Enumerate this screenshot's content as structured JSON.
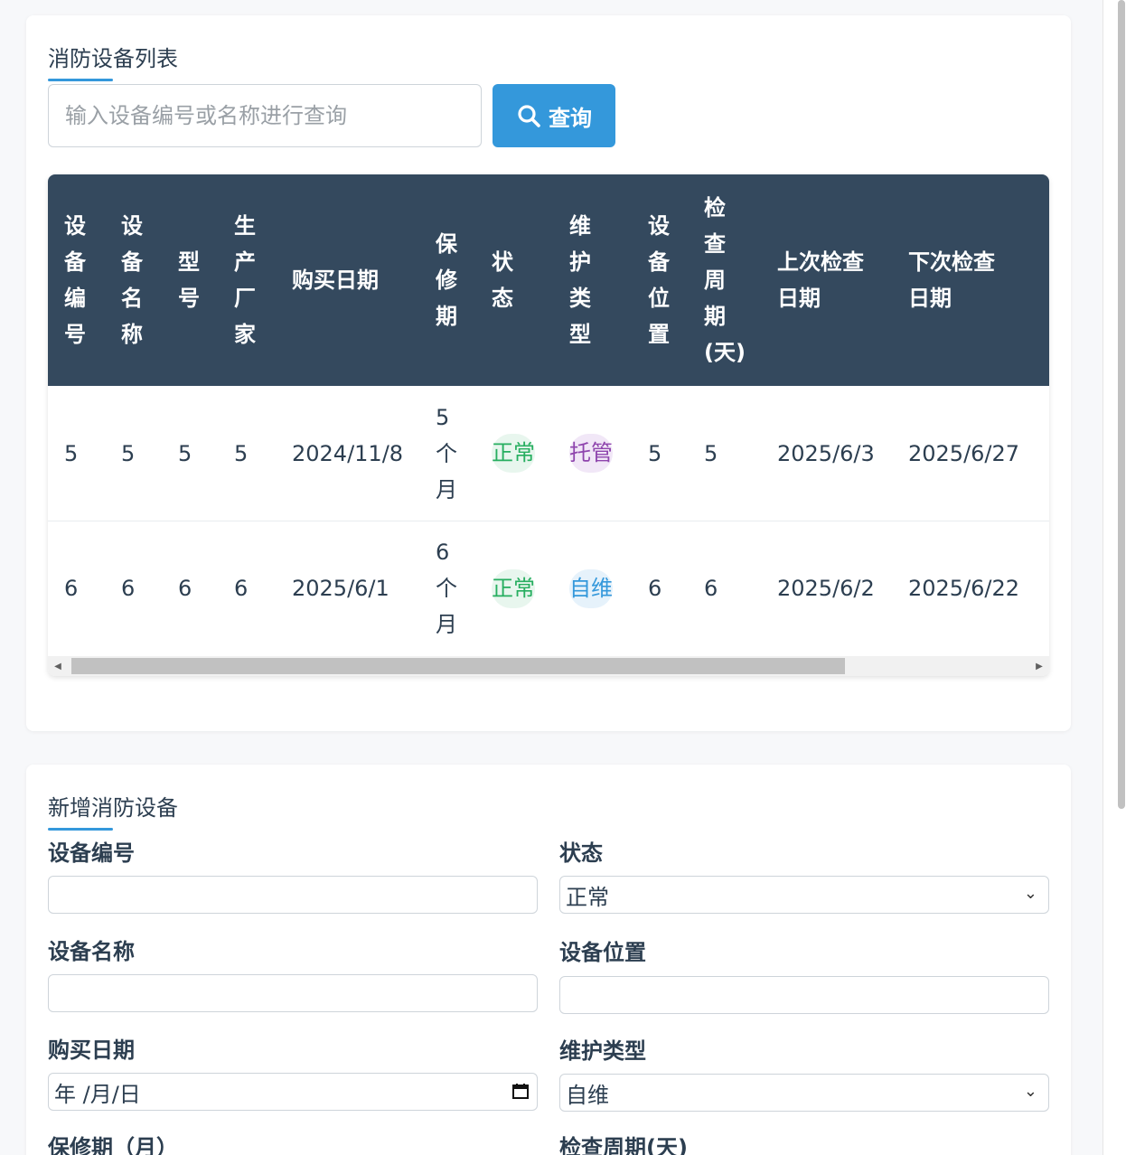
{
  "list": {
    "title": "消防设备列表",
    "search_placeholder": "输入设备编号或名称进行查询",
    "search_label": "查询",
    "headers": [
      "设备编号",
      "设备名称",
      "型号",
      "生产厂家",
      "购买日期",
      "保修期",
      "状态",
      "维护类型",
      "设备位置",
      "检查周期(天)",
      "上次检查日期",
      "下次检查日期"
    ],
    "rows": [
      {
        "id": "5",
        "name": "5",
        "model": "5",
        "maker": "5",
        "purchase": "2024/11/8",
        "warranty": "5个月",
        "status": "正常",
        "maint": "托管",
        "location": "5",
        "cycle": "5",
        "last": "2025/6/3",
        "next": "2025/6/27"
      },
      {
        "id": "6",
        "name": "6",
        "model": "6",
        "maker": "6",
        "purchase": "2025/6/1",
        "warranty": "6个月",
        "status": "正常",
        "maint": "自维",
        "location": "6",
        "cycle": "6",
        "last": "2025/6/2",
        "next": "2025/6/22"
      }
    ]
  },
  "form": {
    "title": "新增消防设备",
    "labels": {
      "id": "设备编号",
      "status": "状态",
      "name": "设备名称",
      "location": "设备位置",
      "purchase": "购买日期",
      "maint": "维护类型",
      "warranty": "保修期（月）",
      "cycle": "检查周期(天)"
    },
    "status_value": "正常",
    "maint_value": "自维",
    "date_placeholder": "年 /月/日"
  },
  "colors": {
    "accent": "#3498db",
    "header_bg": "#34495e",
    "status_green": "#27ae60",
    "maint_purple": "#8e44ad"
  }
}
